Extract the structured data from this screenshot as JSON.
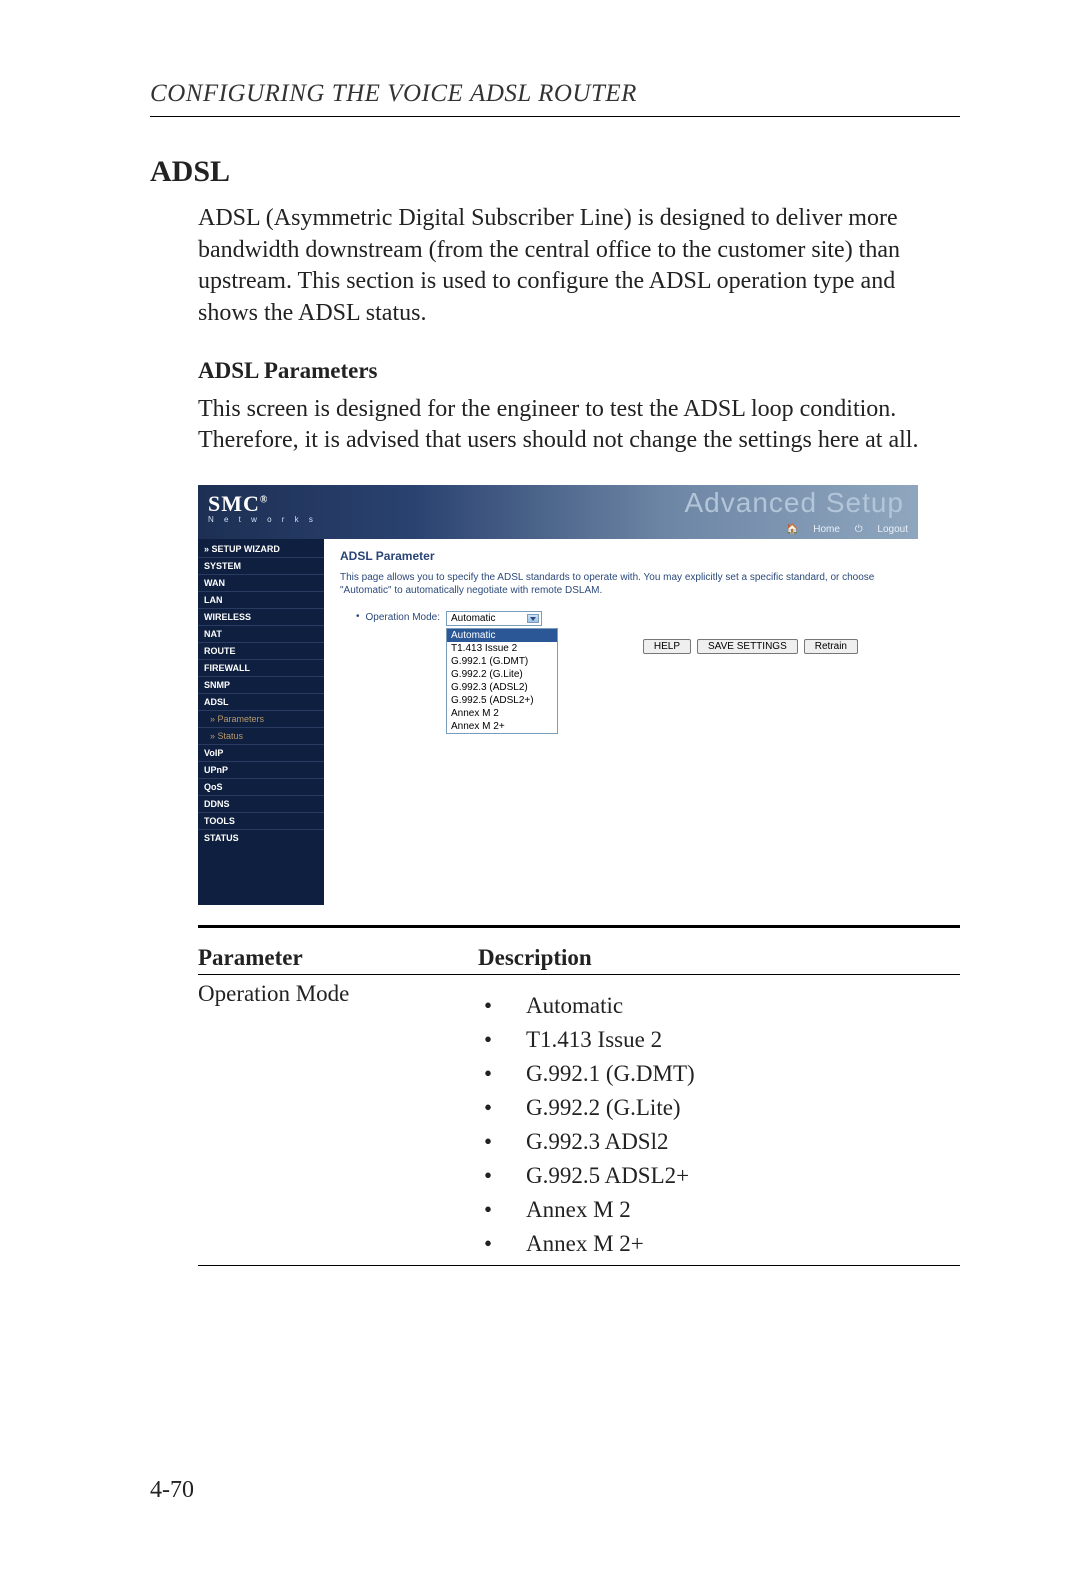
{
  "chapter_head": "Configuring the Voice ADSL Router",
  "h1": "ADSL",
  "intro": "ADSL (Asymmetric Digital Subscriber Line) is designed to deliver more bandwidth downstream (from the central office to the customer site) than upstream. This section is used to configure the ADSL operation type and shows the ADSL status.",
  "h2": "ADSL Parameters",
  "para2": "This screen is designed for the engineer to test the ADSL loop condition. Therefore, it is advised that users should not change the settings here at all.",
  "shot": {
    "brand": "SMC",
    "brand_sup": "®",
    "brand_sub": "N e t w o r k s",
    "banner_title": "Advanced Setup",
    "home": "Home",
    "logout": "Logout",
    "sidebar": [
      "» SETUP WIZARD",
      "SYSTEM",
      "WAN",
      "LAN",
      "WIRELESS",
      "NAT",
      "ROUTE",
      "FIREWALL",
      "SNMP",
      "ADSL"
    ],
    "sidebar_sub": [
      "» Parameters",
      "» Status"
    ],
    "sidebar2": [
      "VoIP",
      "UPnP",
      "QoS",
      "DDNS",
      "TOOLS",
      "STATUS"
    ],
    "panel_title": "ADSL Parameter",
    "panel_desc": "This page allows you to specify the ADSL standards to operate with. You may explicitly set a specific standard, or choose \"Automatic\" to automatically negotiate with remote DSLAM.",
    "opmode_label": "Operation Mode:",
    "opmode_selected": "Automatic",
    "opmode_options": [
      "Automatic",
      "T1.413 Issue 2",
      "G.992.1 (G.DMT)",
      "G.992.2 (G.Lite)",
      "G.992.3 (ADSL2)",
      "G.992.5 (ADSL2+)",
      "Annex M 2",
      "Annex M 2+"
    ],
    "buttons": {
      "help": "HELP",
      "save": "SAVE SETTINGS",
      "retrain": "Retrain"
    }
  },
  "table": {
    "h_param": "Parameter",
    "h_desc": "Description",
    "param": "Operation Mode",
    "items": [
      "Automatic",
      "T1.413 Issue 2",
      "G.992.1 (G.DMT)",
      "G.992.2 (G.Lite)",
      "G.992.3 ADSl2",
      "G.992.5 ADSL2+",
      "Annex M 2",
      "Annex M 2+"
    ]
  },
  "page_num": "4-70"
}
